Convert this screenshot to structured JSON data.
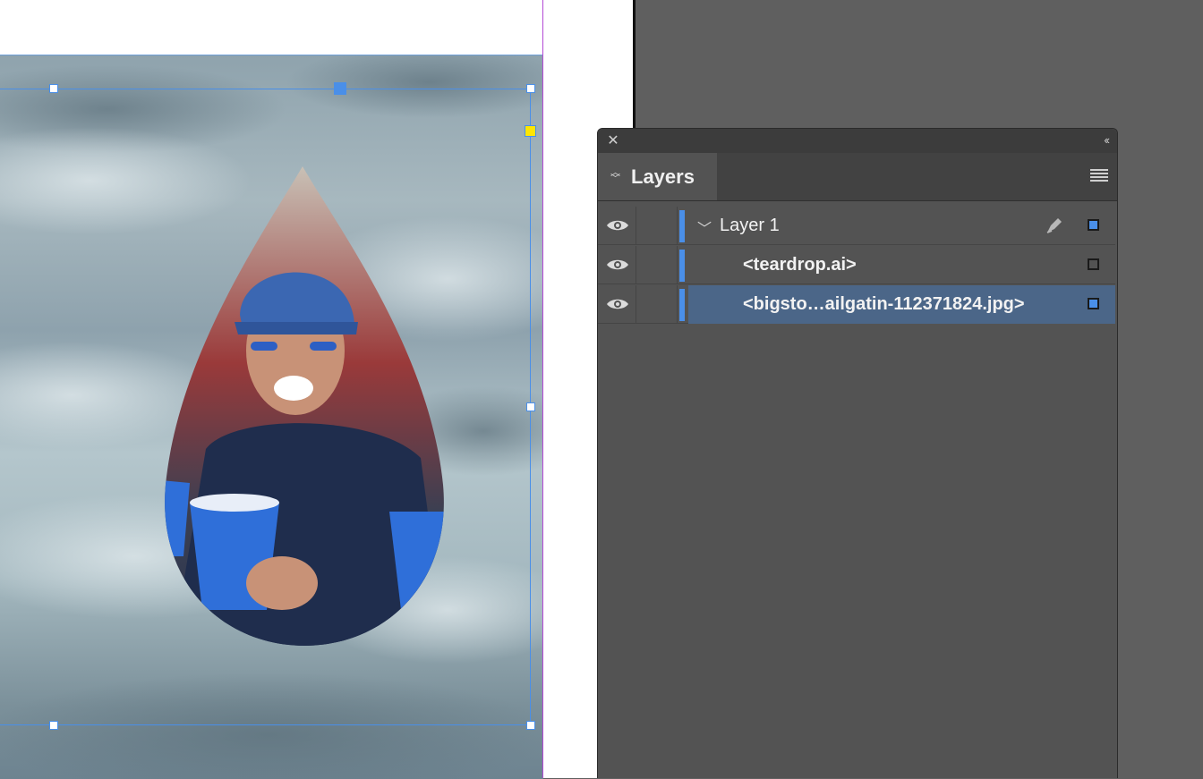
{
  "layers_panel": {
    "title": "Layers",
    "rows": [
      {
        "label": "Layer 1",
        "visible": true,
        "expanded": true,
        "type": "layer",
        "color": "#4a8fe8"
      },
      {
        "label": "<teardrop.ai>",
        "visible": true,
        "type": "item"
      },
      {
        "label": "<bigsto…ailgatin-112371824.jpg>",
        "visible": true,
        "type": "item",
        "selected": true
      }
    ]
  },
  "colors": {
    "selection_blue": "#4a8fe8",
    "margin_purple": "#b44ad6",
    "selected_row": "#4b6688",
    "panel_bg": "#535353",
    "pasteboard": "#5f5f5f"
  },
  "icons": [
    "close-icon",
    "collapse-icon",
    "tab-arrows-icon",
    "panel-menu-icon",
    "eye-icon",
    "chevron-down-icon",
    "pen-icon"
  ]
}
